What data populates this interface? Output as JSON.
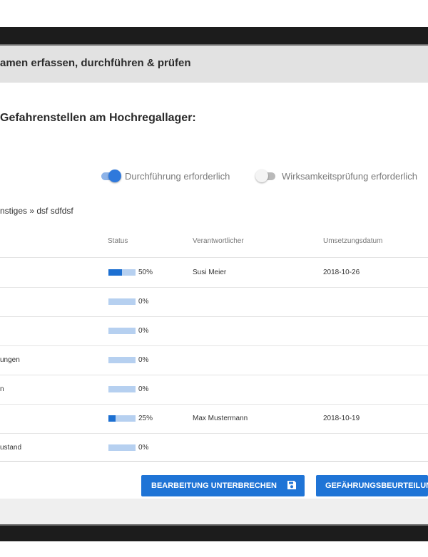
{
  "panel": {
    "title": "amen erfassen, durchführen & prüfen"
  },
  "section": {
    "title": "Gefahrenstellen am Hochregallager:"
  },
  "toggles": [
    {
      "label": "Durchführung erforderlich",
      "on": true
    },
    {
      "label": "Wirksamkeitsprüfung erforderlich",
      "on": false
    }
  ],
  "breadcrumb": "nstiges » dsf sdfdsf",
  "table": {
    "headers": {
      "status": "Status",
      "responsible": "Verantwortlicher",
      "date": "Umsetzungsdatum"
    },
    "rows": [
      {
        "name": "",
        "progress": 50,
        "percent": "50%",
        "responsible": "Susi Meier",
        "date": "2018-10-26"
      },
      {
        "name": "",
        "progress": 0,
        "percent": "0%",
        "responsible": "",
        "date": ""
      },
      {
        "name": "",
        "progress": 0,
        "percent": "0%",
        "responsible": "",
        "date": ""
      },
      {
        "name": "ungen",
        "progress": 0,
        "percent": "0%",
        "responsible": "",
        "date": ""
      },
      {
        "name": "n",
        "progress": 0,
        "percent": "0%",
        "responsible": "",
        "date": ""
      },
      {
        "name": "",
        "progress": 25,
        "percent": "25%",
        "responsible": "Max Mustermann",
        "date": "2018-10-19"
      },
      {
        "name": "ustand",
        "progress": 0,
        "percent": "0%",
        "responsible": "",
        "date": ""
      }
    ]
  },
  "buttons": {
    "pause": "BEARBEITUNG UNTERBRECHEN",
    "risk": "GEFÄHRUNGSBEURTEILUNG"
  },
  "colors": {
    "accent": "#1f74d6",
    "progress_track": "#b6d0f0",
    "progress_fill": "#1c6fd1"
  }
}
